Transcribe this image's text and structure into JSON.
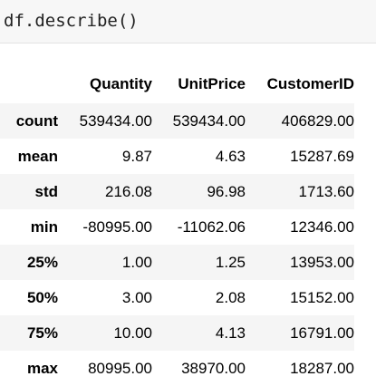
{
  "input_cell": {
    "code": "df.describe()"
  },
  "table": {
    "corner": "",
    "columns": [
      "Quantity",
      "UnitPrice",
      "CustomerID"
    ],
    "rows": [
      {
        "label": "count",
        "values": [
          "539434.00",
          "539434.00",
          "406829.00"
        ]
      },
      {
        "label": "mean",
        "values": [
          "9.87",
          "4.63",
          "15287.69"
        ]
      },
      {
        "label": "std",
        "values": [
          "216.08",
          "96.98",
          "1713.60"
        ]
      },
      {
        "label": "min",
        "values": [
          "-80995.00",
          "-11062.06",
          "12346.00"
        ]
      },
      {
        "label": "25%",
        "values": [
          "1.00",
          "1.25",
          "13953.00"
        ]
      },
      {
        "label": "50%",
        "values": [
          "3.00",
          "2.08",
          "15152.00"
        ]
      },
      {
        "label": "75%",
        "values": [
          "10.00",
          "4.13",
          "16791.00"
        ]
      },
      {
        "label": "max",
        "values": [
          "80995.00",
          "38970.00",
          "18287.00"
        ]
      }
    ]
  },
  "colors": {
    "input_background": "#f7f7f7",
    "stripe_background": "#f5f5f5"
  }
}
